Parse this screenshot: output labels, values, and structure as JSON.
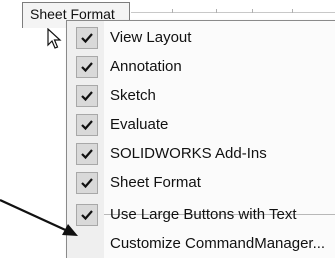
{
  "sheet_tab": {
    "label": "Sheet Format"
  },
  "menu": {
    "items": [
      {
        "label": "View Layout",
        "checked": true
      },
      {
        "label": "Annotation",
        "checked": true
      },
      {
        "label": "Sketch",
        "checked": true
      },
      {
        "label": "Evaluate",
        "checked": true
      },
      {
        "label": "SOLIDWORKS Add-Ins",
        "checked": true
      },
      {
        "label": "Sheet Format",
        "checked": true
      },
      {
        "label": "Use Large Buttons with Text",
        "checked": true
      },
      {
        "label": "Customize CommandManager...",
        "checked": false
      }
    ]
  },
  "colors": {
    "check_box_bg": "#d9d9d9",
    "gutter_bg": "#efefef",
    "arrow": "#111111"
  },
  "icons": {
    "checkmark": "checkmark-icon",
    "cursor": "mouse-pointer-icon",
    "annotation_arrow": "annotation-arrow-icon"
  }
}
